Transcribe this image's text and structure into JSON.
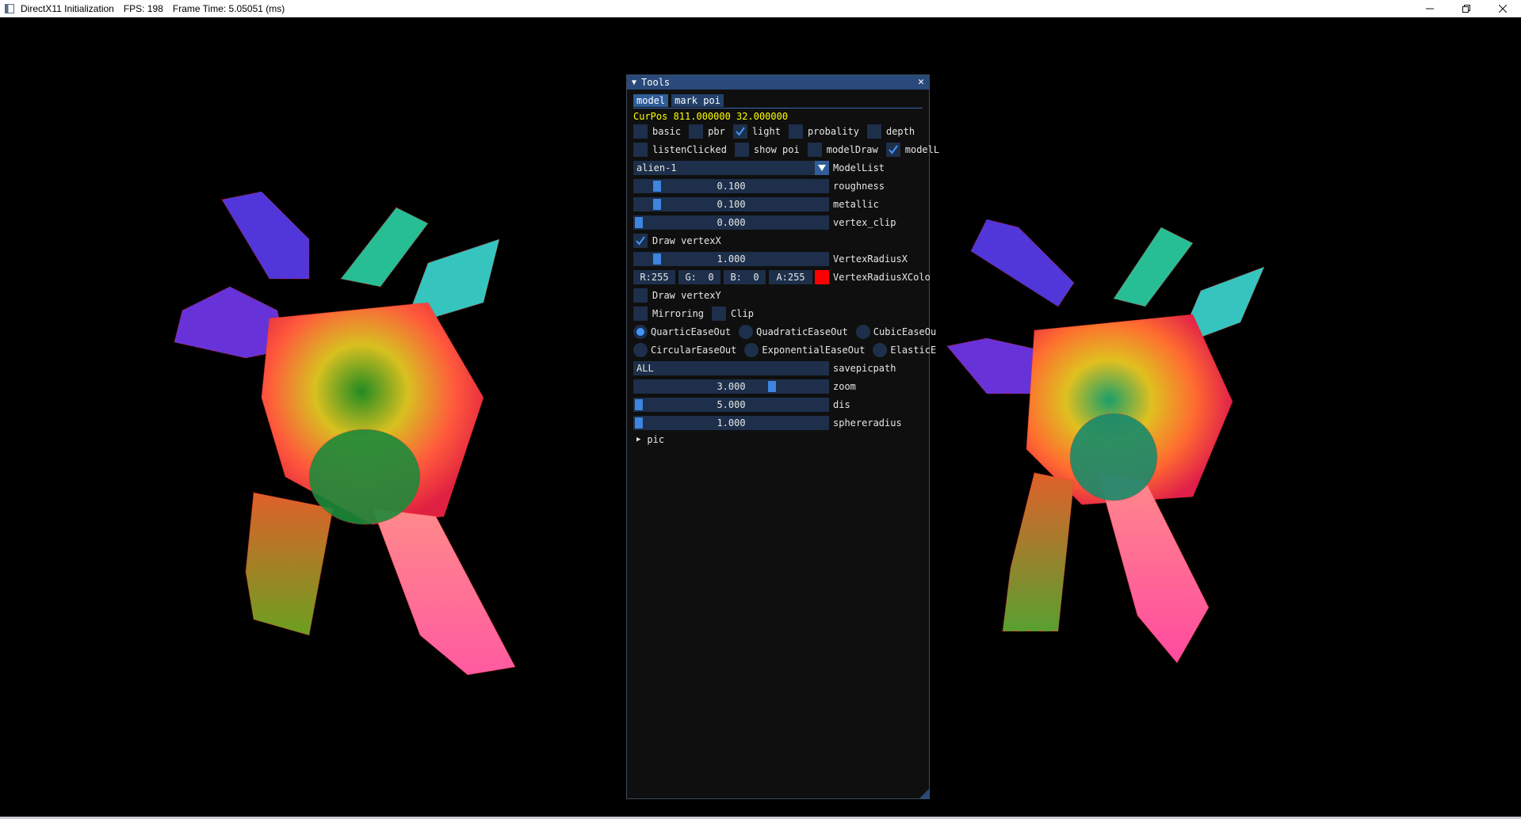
{
  "window": {
    "title": "DirectX11 Initialization",
    "fps_label": "FPS: 198",
    "frame_time_label": "Frame Time: 5.05051 (ms)",
    "controls": {
      "minimize": "—",
      "maximize": "❐",
      "close": "✕"
    }
  },
  "tools": {
    "title": "Tools",
    "collapse_icon": "triangle-down-icon",
    "close_icon": "close-icon",
    "tabs": [
      {
        "label": "model",
        "active": true
      },
      {
        "label": "mark poi",
        "active": false
      }
    ],
    "curpos": "CurPos 811.000000 32.000000",
    "checkboxes_row1": [
      {
        "label": "basic",
        "checked": false
      },
      {
        "label": "pbr",
        "checked": false
      },
      {
        "label": "light",
        "checked": true
      },
      {
        "label": "probality",
        "checked": false
      },
      {
        "label": "depth",
        "checked": false
      }
    ],
    "checkboxes_row2": [
      {
        "label": "listenClicked",
        "checked": false
      },
      {
        "label": "show poi",
        "checked": false
      },
      {
        "label": "modelDraw",
        "checked": false
      },
      {
        "label": "modelL",
        "checked": true
      }
    ],
    "model_list": {
      "value": "alien-1",
      "label": "ModelList"
    },
    "roughness": {
      "value": "0.100",
      "label": "roughness",
      "fraction": 0.1
    },
    "metallic": {
      "value": "0.100",
      "label": "metallic",
      "fraction": 0.1
    },
    "vertex_clip": {
      "value": "0.000",
      "label": "vertex_clip",
      "fraction": 0.0
    },
    "draw_vertex_x": {
      "label": "Draw vertexX",
      "checked": true
    },
    "vertex_radius_x": {
      "value": "1.000",
      "label": "VertexRadiusX",
      "fraction": 0.1
    },
    "vertex_color": {
      "r": "R:255",
      "g": "G:  0",
      "b": "B:  0",
      "a": "A:255",
      "label": "VertexRadiusXColo",
      "swatch": "#ff0000"
    },
    "draw_vertex_y": {
      "label": "Draw vertexY",
      "checked": false
    },
    "mirroring": {
      "label": "Mirroring",
      "checked": false
    },
    "clip": {
      "label": "Clip",
      "checked": false
    },
    "easing_row1": [
      {
        "label": "QuarticEaseOut",
        "selected": true
      },
      {
        "label": "QuadraticEaseOut",
        "selected": false
      },
      {
        "label": "CubicEaseOu",
        "selected": false
      }
    ],
    "easing_row2": [
      {
        "label": "CircularEaseOut",
        "selected": false
      },
      {
        "label": "ExponentialEaseOut",
        "selected": false
      },
      {
        "label": "ElasticE",
        "selected": false
      }
    ],
    "savepicpath": {
      "value": "ALL",
      "label": "savepicpath"
    },
    "zoom": {
      "value": "3.000",
      "label": "zoom",
      "fraction": 0.72
    },
    "dis": {
      "value": "5.000",
      "label": "dis",
      "fraction": 0.0
    },
    "sphereradius": {
      "value": "1.000",
      "label": "sphereradius",
      "fraction": 0.0
    },
    "pic_node": {
      "label": "pic"
    }
  },
  "colors": {
    "frame_bg": "#1d2f4a",
    "accent": "#3d85e0",
    "title_bg": "#294a7a",
    "curpos_text": "#ffff00"
  }
}
